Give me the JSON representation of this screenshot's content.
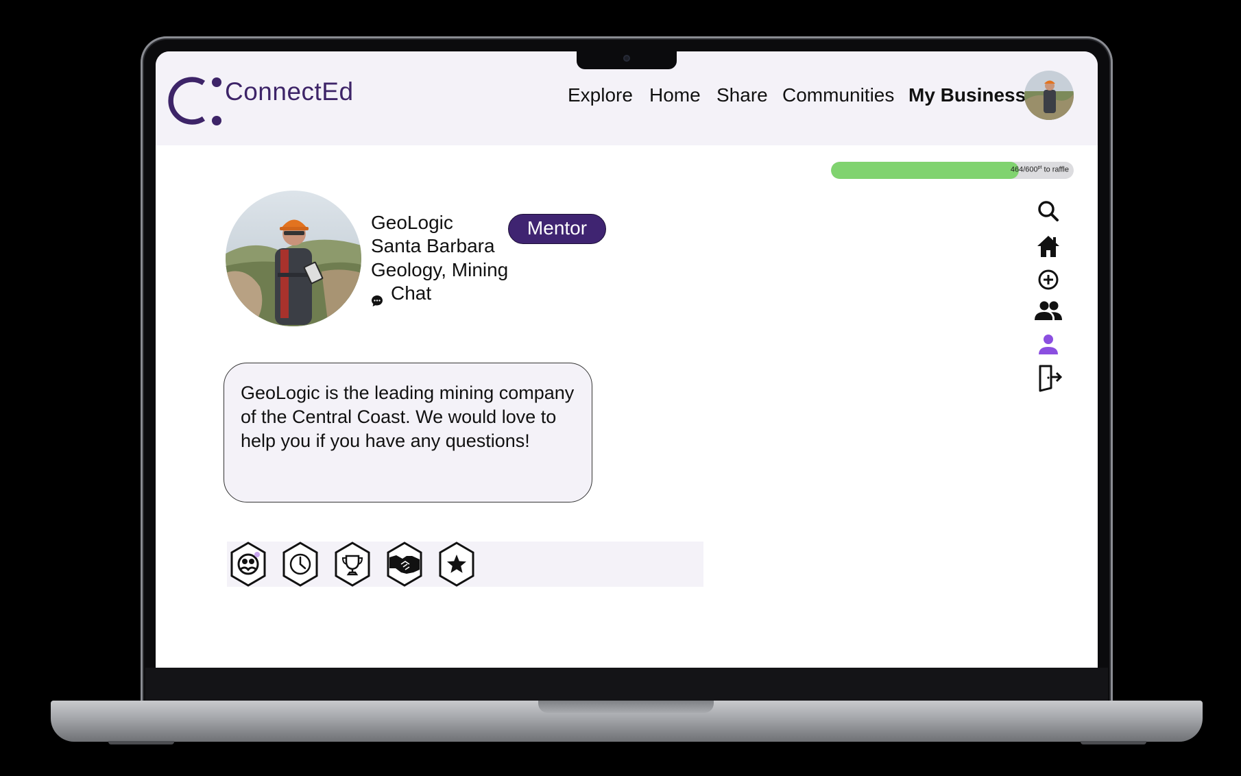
{
  "app": {
    "logo_text": "ConnectEd"
  },
  "nav": {
    "items": [
      {
        "label": "Explore"
      },
      {
        "label": "Home"
      },
      {
        "label": "Share"
      },
      {
        "label": "Communities"
      },
      {
        "label": "My Business",
        "active": true
      }
    ]
  },
  "progress": {
    "current": "464",
    "total": "600",
    "unit_sup": "pt",
    "suffix": " to raffle",
    "fraction": 0.773
  },
  "profile": {
    "name": "GeoLogic",
    "location": "Santa Barbara",
    "fields": "Geology, Mining",
    "chat_label": "Chat",
    "role_badge": "Mentor",
    "bio": "GeoLogic is the leading mining company of the Central Coast. We would love to help you if you have any questions!"
  },
  "badges": [
    {
      "icon": "community-badge-icon"
    },
    {
      "icon": "clock-badge-icon"
    },
    {
      "icon": "trophy-badge-icon"
    },
    {
      "icon": "handshake-badge-icon"
    },
    {
      "icon": "star-badge-icon"
    }
  ],
  "side_nav": [
    {
      "icon": "search-icon"
    },
    {
      "icon": "home-icon"
    },
    {
      "icon": "add-circle-icon"
    },
    {
      "icon": "group-icon"
    },
    {
      "icon": "person-icon",
      "active": true
    },
    {
      "icon": "logout-icon"
    }
  ],
  "colors": {
    "brand": "#3d2468",
    "badge_bg": "#3f2471",
    "header_bg": "#f4f2f8",
    "progress_fill": "#80d36f",
    "active_icon": "#8b4fe0"
  }
}
